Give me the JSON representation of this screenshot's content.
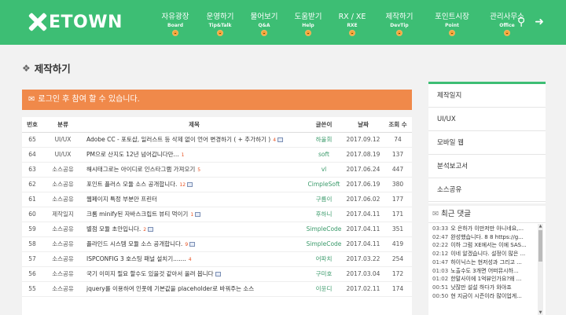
{
  "brand": {
    "logo_text": "ETOWN"
  },
  "nav": [
    {
      "kr": "자유광장",
      "en": "Board"
    },
    {
      "kr": "운영하기",
      "en": "Tip&Talk"
    },
    {
      "kr": "물어보기",
      "en": "Q&A"
    },
    {
      "kr": "도움받기",
      "en": "Help"
    },
    {
      "kr": "RX / XE",
      "en": "RXE"
    },
    {
      "kr": "제작하기",
      "en": "DevTip"
    },
    {
      "kr": "포인트시장",
      "en": "Point"
    },
    {
      "kr": "관리사무소",
      "en": "Office"
    }
  ],
  "page": {
    "title": "제작하기"
  },
  "notice": "로그인 후 참여 할 수 있습니다.",
  "table": {
    "headers": {
      "num": "번호",
      "category": "분류",
      "title": "제목",
      "author": "글쓴이",
      "date": "날짜",
      "views": "조회 수"
    },
    "rows": [
      {
        "num": "65",
        "category": "UI/UX",
        "title": "Adobe CC - 포토샵, 일러스트 등 삭제 없이 언어 변경하기 ( + 추가하기 )",
        "comments": "4",
        "attach": true,
        "author": "하울회",
        "date": "2017.09.12",
        "views": "74"
      },
      {
        "num": "64",
        "category": "UI/UX",
        "title": "PM으로 산지도 12년 넘어갑니다만...",
        "comments": "1",
        "attach": false,
        "author": "soft",
        "date": "2017.08.19",
        "views": "137"
      },
      {
        "num": "63",
        "category": "소스공유",
        "title": "해시태그로는 아이디로 인스타그램 가져오기",
        "comments": "5",
        "attach": false,
        "author": "vl",
        "date": "2017.06.24",
        "views": "447"
      },
      {
        "num": "62",
        "category": "소스공유",
        "title": "포인트 플러스 모듈 소스 공개합니다.",
        "comments": "12",
        "attach": true,
        "author": "CimpleSoft",
        "date": "2017.06.19",
        "views": "380"
      },
      {
        "num": "61",
        "category": "소스공유",
        "title": "웹페이지 특정 부분만 프린터",
        "comments": "",
        "attach": false,
        "author": "구름이",
        "date": "2017.06.02",
        "views": "177"
      },
      {
        "num": "60",
        "category": "제작일지",
        "title": "크롬 minify된 자바스크립트 뷰티 먹이기",
        "comments": "1",
        "attach": true,
        "author": "후하니",
        "date": "2017.04.11",
        "views": "171"
      },
      {
        "num": "59",
        "category": "소스공유",
        "title": "별점 모듈 초안입니다.",
        "comments": "2",
        "attach": true,
        "author": "SimpleCode",
        "date": "2017.04.11",
        "views": "351"
      },
      {
        "num": "58",
        "category": "소스공유",
        "title": "플라인드 시스템 모듈 소스 공개합니다.",
        "comments": "9",
        "attach": true,
        "author": "SimpleCode",
        "date": "2017.04.11",
        "views": "419"
      },
      {
        "num": "57",
        "category": "소스공유",
        "title": "ISPCONFIG 3 호스팅 패널 설치기.......",
        "comments": "4",
        "attach": false,
        "author": "어파치",
        "date": "2017.03.22",
        "views": "254"
      },
      {
        "num": "56",
        "category": "소스공유",
        "title": "국기 이미지 필요 할수도 있을것 같아서 올려 봅니다",
        "comments": "",
        "attach": true,
        "author": "구미호",
        "date": "2017.03.04",
        "views": "172"
      },
      {
        "num": "55",
        "category": "소스공유",
        "title": "jquery를 이용하여 인풋에 기본값을 placeholder로 바꿔주는 소스",
        "comments": "",
        "attach": false,
        "author": "이윤디",
        "date": "2017.02.11",
        "views": "174"
      }
    ]
  },
  "sidebar": {
    "menu": [
      "제작일지",
      "UI/UX",
      "모바일 웹",
      "분석보고서",
      "소스공유"
    ],
    "recent_title": "최근 댓글",
    "recent": [
      {
        "time": "03:33",
        "text": "오 은하가 이만저만 아니네요,..."
      },
      {
        "time": "02:47",
        "text": "완성했습니다. 8 8 https://g..."
      },
      {
        "time": "02:22",
        "text": "이하 그럼 XE에서는 이에 SAS..."
      },
      {
        "time": "02:12",
        "text": "이네 알겠습니다. 설정이 많은 ..."
      },
      {
        "time": "01:47",
        "text": "하이닉스는 현저성과 그리고 ..."
      },
      {
        "time": "01:03",
        "text": "노출수도 3개면 어떠뮤시하..."
      },
      {
        "time": "01:02",
        "text": "한말사이에 1억뷰인가요?왜 ..."
      },
      {
        "time": "00:51",
        "text": "낫잖만 설설 하다가 와야죠"
      },
      {
        "time": "00:50",
        "text": "현 지금이 시즌이라 많이업게..."
      }
    ]
  }
}
